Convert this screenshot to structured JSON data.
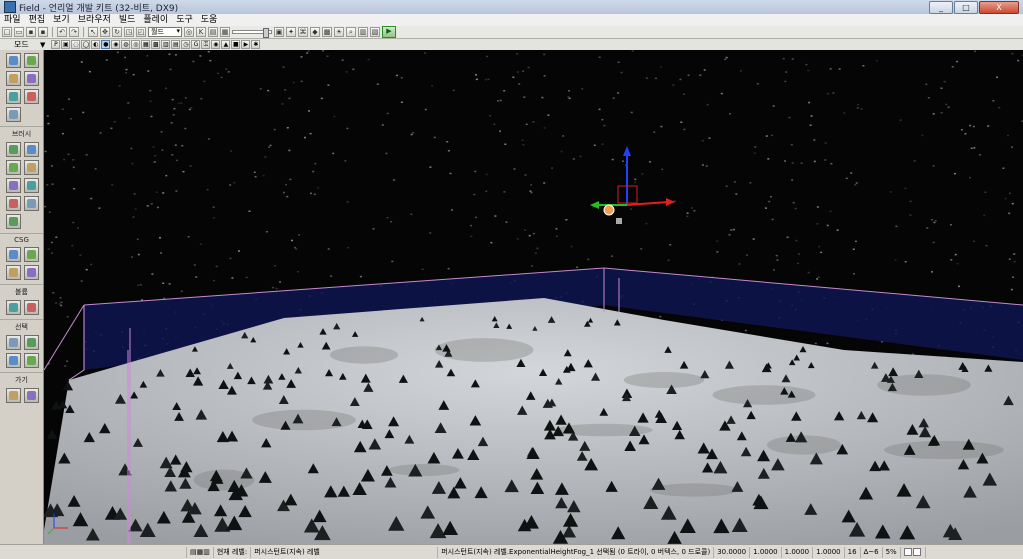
{
  "window": {
    "title": "Field - 언리얼 개발 키트 (32-비트, DX9)",
    "controls": [
      "_",
      "□",
      "X"
    ]
  },
  "menu": [
    "파일",
    "편집",
    "보기",
    "브라우저",
    "빌드",
    "플레이",
    "도구",
    "도움"
  ],
  "toolbar": {
    "mode_select": "월드",
    "zoom_select": "",
    "play_label": "▶"
  },
  "modebar": {
    "label": "모드",
    "dropdown": "▼",
    "p_button": "P"
  },
  "sidebar": {
    "sections": [
      {
        "label": "",
        "rows": [
          [
            "camera-mode-icon",
            "geometry-mode-icon"
          ],
          [
            "terrain-mode-icon",
            "move-mode-icon"
          ],
          [
            "texture-align-icon",
            "volume-icon"
          ],
          [
            "eye-icon"
          ]
        ]
      },
      {
        "label": "브러시",
        "rows": [
          [
            "cube-brush-icon",
            "cone-brush-icon"
          ],
          [
            "stairs-brush-icon",
            "cylinder-brush-icon"
          ],
          [
            "curved-stair-icon",
            "sheet-brush-icon"
          ],
          [
            "spiral-stair-icon",
            "sphere-brush-icon"
          ],
          [
            "volumetric-brush-icon"
          ]
        ]
      },
      {
        "label": "CSG",
        "rows": [
          [
            "csg-add-icon",
            "csg-subtract-icon"
          ],
          [
            "csg-intersect-icon",
            "csg-deintersect-icon"
          ]
        ]
      },
      {
        "label": "볼륨",
        "rows": [
          [
            "add-volume-icon",
            "volume-list-icon"
          ]
        ]
      },
      {
        "label": "선택",
        "rows": [
          [
            "show-selected-icon",
            "hide-selected-icon"
          ],
          [
            "select-invert-icon",
            "show-all-icon"
          ]
        ]
      },
      {
        "label": "가기",
        "rows": [
          [
            "goto-actor-icon",
            "goto-builder-icon"
          ]
        ]
      }
    ]
  },
  "viewport": {
    "background": "#050506",
    "ground_color": "#c6c9cd",
    "volume_color": "#101a5a",
    "widget": {
      "x_color": "#e02020",
      "y_color": "#20c020",
      "z_color": "#2040ff"
    }
  },
  "statusbar": {
    "level_prefix": "현재 레벨:",
    "level_name": "퍼시스턴트(지속) 레벨",
    "selection_text": "퍼시스턴트(지속) 레벨.ExponentialHeightFog_1 선택됨 (0 트라이, 0 버텍스, 0 드로콜)",
    "value1": "30.0000",
    "value2": "1.0000",
    "value3": "1.0000",
    "value4": "1.0000",
    "grid": "16",
    "rot_snap": "∆~6",
    "scale_snap": "5%"
  }
}
